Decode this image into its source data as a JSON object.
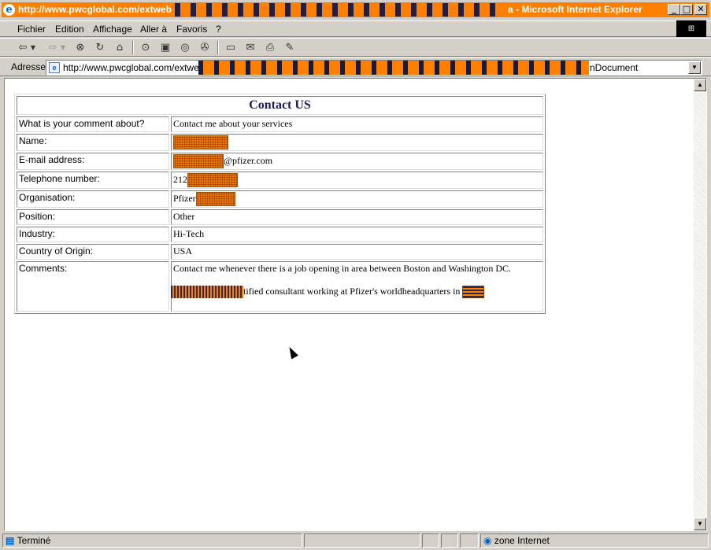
{
  "window": {
    "title_url": "http://www.pwcglobal.com/extweb",
    "title_app": "a - Microsoft Internet Explorer",
    "minimize": "_",
    "maximize": "□",
    "close": "✕"
  },
  "menu": [
    "Fichier",
    "Edition",
    "Affichage",
    "Aller à",
    "Favoris",
    "?"
  ],
  "address": {
    "label": "Adresse",
    "url_start": "http://www.pwcglobal.com/extweb",
    "url_end": "nDocument"
  },
  "form": {
    "title": "Contact US",
    "rows": [
      {
        "label": "What is your comment about?",
        "value": "Contact me about your services"
      },
      {
        "label": "Name:",
        "value": ""
      },
      {
        "label": "E-mail address:",
        "value": "@pfizer.com"
      },
      {
        "label": "Telephone number:",
        "value": "212"
      },
      {
        "label": "Organisation:",
        "value": "Pfizer"
      },
      {
        "label": "Position:",
        "value": "Other"
      },
      {
        "label": "Industry:",
        "value": "Hi-Tech"
      },
      {
        "label": "Country of Origin:",
        "value": "USA"
      }
    ],
    "comments_label": "Comments:",
    "comments_line1": "Contact me whenever there is a job opening in area between Boston and Washington DC.",
    "comments_line2": "tified consultant working at Pfizer's worldheadquarters in"
  },
  "status": {
    "text": "Terminé",
    "zone": "zone Internet"
  },
  "colors": {
    "redaction": "#ff8000",
    "form_title": "#1a1a60"
  }
}
